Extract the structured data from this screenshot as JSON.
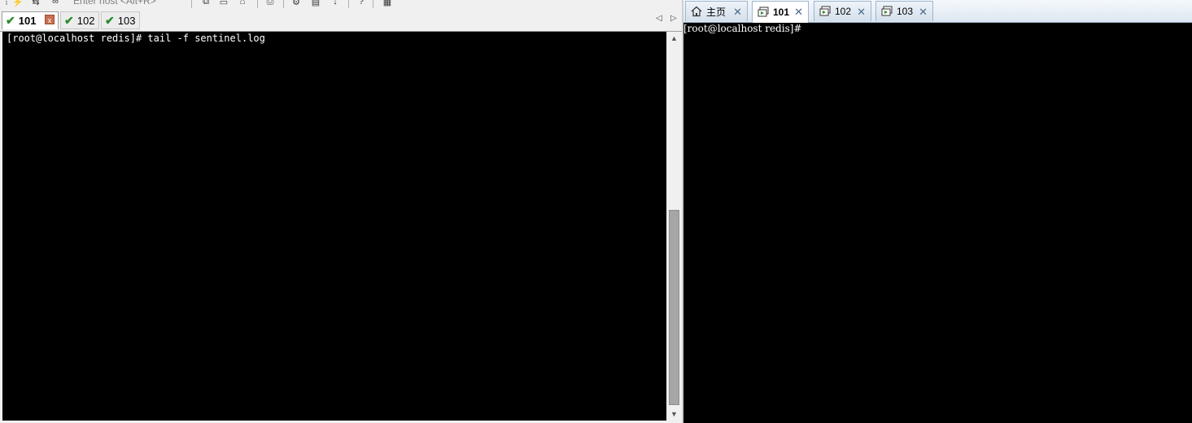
{
  "left_window": {
    "toolbar": {
      "enter_host_placeholder": "Enter host <Alt+R>"
    },
    "tabs": [
      {
        "label": "101",
        "status_icon": "check-icon",
        "active": true
      },
      {
        "label": "102",
        "status_icon": "check-icon",
        "active": false
      },
      {
        "label": "103",
        "status_icon": "check-icon",
        "active": false
      }
    ],
    "close_glyph": "x",
    "nav_prev": "◁",
    "nav_next": "▷",
    "terminal": {
      "line1": "[root@localhost redis]# tail -f sentinel.log"
    }
  },
  "right_window": {
    "tabs": [
      {
        "label": "主页",
        "icon": "home-icon",
        "active": false
      },
      {
        "label": "101",
        "icon": "session-icon",
        "active": true
      },
      {
        "label": "102",
        "icon": "session-icon",
        "active": false
      },
      {
        "label": "103",
        "icon": "session-icon",
        "active": false
      }
    ],
    "close_glyph": "✕",
    "terminal": {
      "line1": "[root@localhost redis]#"
    }
  },
  "colors": {
    "terminal_bg": "#000000",
    "terminal_fg": "#ffffff",
    "check_green": "#2a8a2a",
    "tab_border_blue": "#9fb5cc"
  }
}
